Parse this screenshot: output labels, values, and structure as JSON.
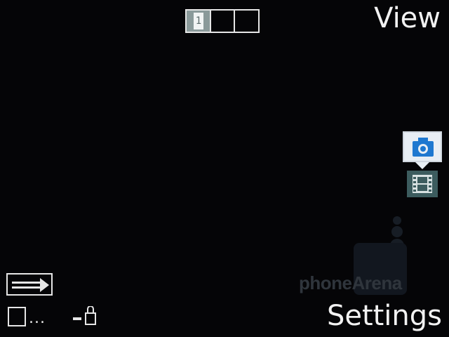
{
  "softkeys": {
    "right_top": "View",
    "right_bottom": "Settings"
  },
  "counter": {
    "cells": 3,
    "active_index": 1,
    "active_label": "1"
  },
  "mode_switch": {
    "photo_icon": "camera-icon",
    "video_icon": "film-icon",
    "selected": "photo"
  },
  "watermark": {
    "text": "phoneArena"
  },
  "status": {
    "icons": [
      "arrow-right-box-icon",
      "storage-card-icon",
      "lock-icon"
    ],
    "storage_more": "..."
  },
  "colors": {
    "background": "#050507",
    "foreground": "#f2f2f2",
    "photo_mode": "#e8eef4",
    "video_mode": "#3c5c5e"
  }
}
